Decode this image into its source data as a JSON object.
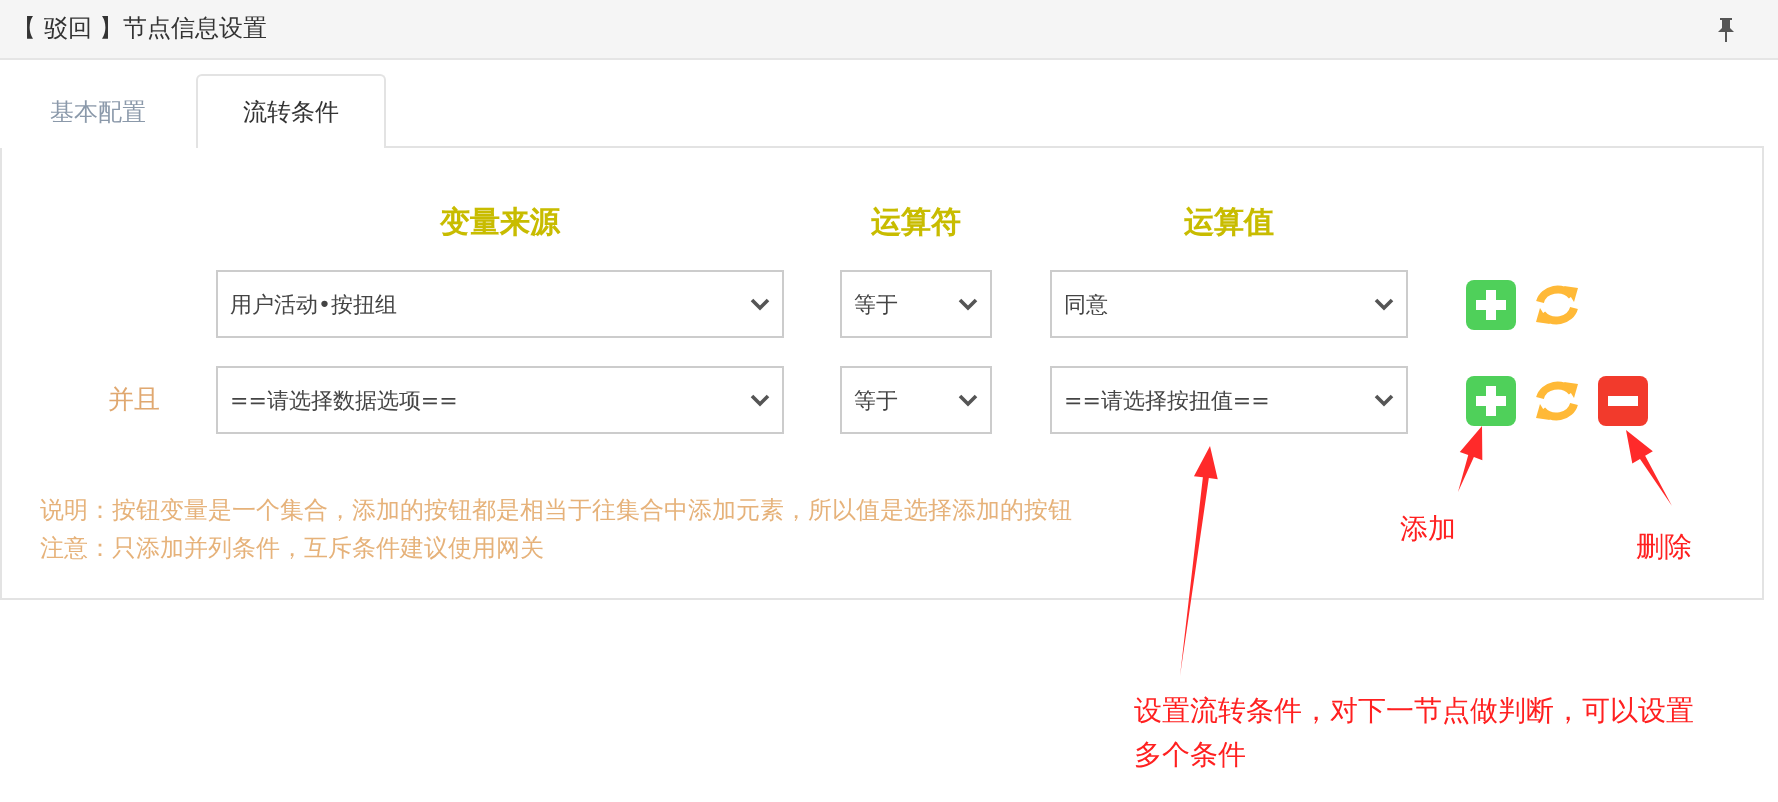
{
  "window": {
    "title": "【 驳回 】节点信息设置"
  },
  "tabs": [
    {
      "label": "基本配置",
      "selected": false
    },
    {
      "label": "流转条件",
      "selected": true
    }
  ],
  "headers": [
    "变量来源",
    "运算符",
    "运算值"
  ],
  "rows": [
    {
      "conjunction": "",
      "source": "用户活动•按扭组",
      "operator": "等于",
      "value": "同意",
      "actions": [
        {
          "kind": "add"
        },
        {
          "kind": "refresh"
        }
      ]
    },
    {
      "conjunction": "并且",
      "source": "==请选择数据选项==",
      "operator": "等于",
      "value": "==请选择按扭值==",
      "actions": [
        {
          "kind": "add"
        },
        {
          "kind": "refresh"
        },
        {
          "kind": "remove"
        }
      ]
    }
  ],
  "notes": [
    "说明：按钮变量是一个集合，添加的按钮都是相当于往集合中添加元素，所以值是选择添加的按钮",
    "注意：只添加并列条件，互斥条件建议使用网关"
  ],
  "annotations": {
    "add": "添加",
    "remove": "删除",
    "conditions": "设置流转条件，对下一节点做判断，可以设置多个条件"
  }
}
